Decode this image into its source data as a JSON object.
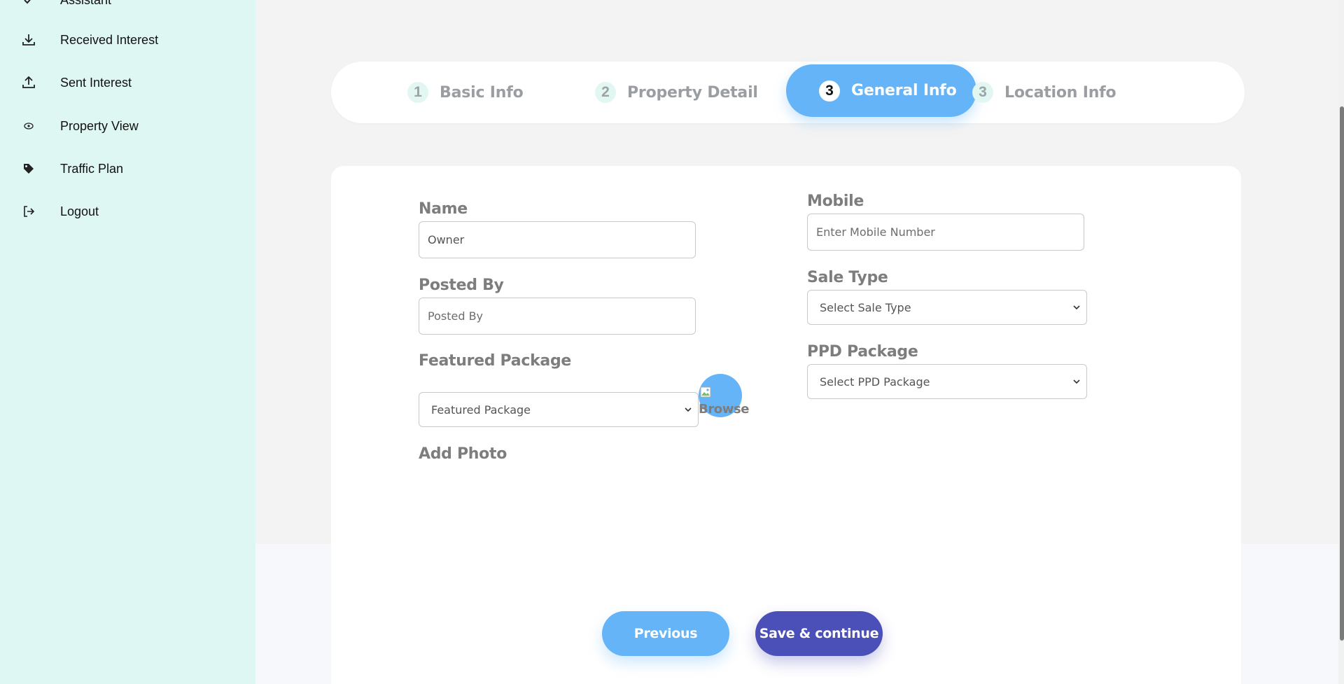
{
  "sidebar": {
    "items": [
      {
        "label": "Assistant",
        "icon": "check-icon"
      },
      {
        "label": "Received Interest",
        "icon": "download-icon"
      },
      {
        "label": "Sent Interest",
        "icon": "upload-icon"
      },
      {
        "label": "Property View",
        "icon": "eye-icon"
      },
      {
        "label": "Traffic Plan",
        "icon": "tag-icon"
      },
      {
        "label": "Logout",
        "icon": "logout-icon"
      }
    ]
  },
  "stepper": {
    "steps": [
      {
        "number": "1",
        "label": "Basic Info",
        "active": false
      },
      {
        "number": "2",
        "label": "Property Detail",
        "active": false
      },
      {
        "number": "3",
        "label": "General Info",
        "active": true
      },
      {
        "number": "3",
        "label": "Location Info",
        "active": false
      }
    ]
  },
  "form": {
    "name": {
      "label": "Name",
      "value": "Owner",
      "placeholder": "Owner"
    },
    "posted_by": {
      "label": "Posted By",
      "value": "",
      "placeholder": "Posted By"
    },
    "featured_package": {
      "label": "Featured Package",
      "selected": "Featured Package"
    },
    "add_photo": {
      "label": "Add Photo",
      "browse_alt": "Browse"
    },
    "mobile": {
      "label": "Mobile",
      "value": "",
      "placeholder": "Enter Mobile Number"
    },
    "sale_type": {
      "label": "Sale Type",
      "selected": "Select Sale Type"
    },
    "ppd_package": {
      "label": "PPD Package",
      "selected": "Select PPD Package"
    }
  },
  "actions": {
    "previous_label": "Previous",
    "save_label": "Save & continue"
  },
  "colors": {
    "sidebar_bg": "#dff7f3",
    "accent_blue": "#64b4f7",
    "save_indigo": "#4b4fb8",
    "label_gray": "#7d7d7d"
  }
}
